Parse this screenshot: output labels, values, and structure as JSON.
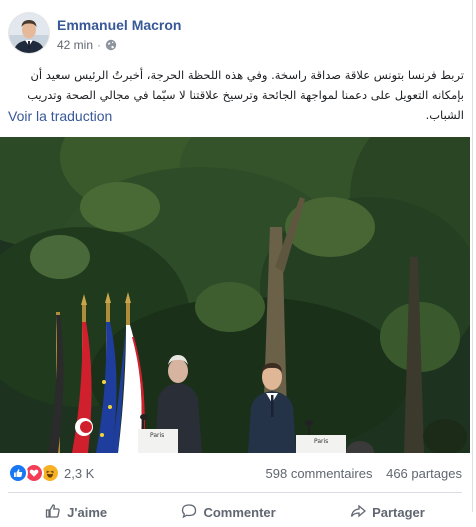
{
  "post": {
    "author": "Emmanuel Macron",
    "time": "42 min",
    "separator": "·",
    "privacy_icon": "globe-icon",
    "text": "تربط فرنسا بتونس علاقة صداقة راسخة. وفي هذه اللحظة الحرجة، أخبرتُ الرئيس سعيد أن بإمكانه التعويل على دعمنا لمواجهة الجائحة وترسيخ علاقتنا لا سيّما في مجالي الصحة وتدريب الشباب.",
    "translate_label": "Voir la traduction"
  },
  "photo": {
    "lectern_left": "Paris",
    "lectern_right": "Paris"
  },
  "stats": {
    "reactions": [
      "like-icon",
      "love-icon",
      "haha-icon"
    ],
    "reaction_count": "2,3 K",
    "comments": "598 commentaires",
    "shares": "466 partages"
  },
  "actions": {
    "like": "J'aime",
    "comment": "Commenter",
    "share": "Partager"
  },
  "colors": {
    "link": "#385898",
    "like": "#1877f2",
    "love": "#f33e58",
    "haha": "#f7b125"
  }
}
